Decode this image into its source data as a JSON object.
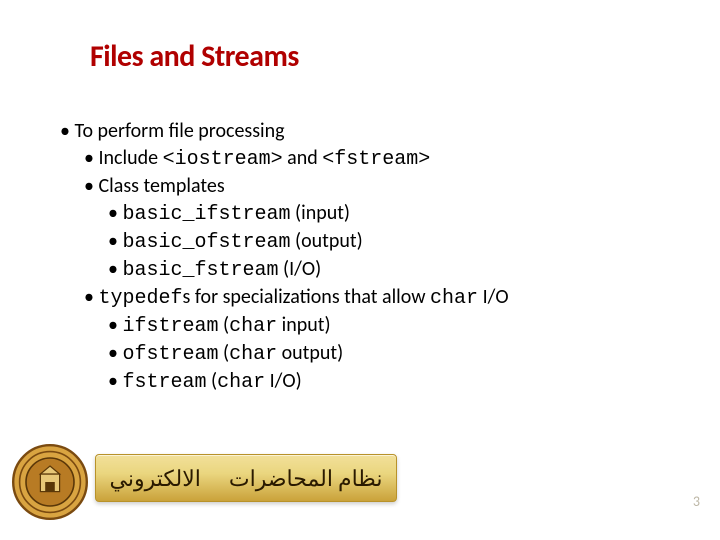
{
  "title": "Files and Streams",
  "bullets": {
    "b0": "To perform file processing",
    "b1_pre": "Include ",
    "b1_c1": "<iostream>",
    "b1_mid": " and ",
    "b1_c2": "<fstream>",
    "b2": "Class templates",
    "b3_c": "basic_ifstream",
    "b3_t": " (input)",
    "b4_c": "basic_ofstream",
    "b4_t": " (output)",
    "b5_c": "basic_fstream",
    "b5_t": " (I/O)",
    "b6_c1": "typedef",
    "b6_t1": "s for specializations that allow ",
    "b6_c2": "char",
    "b6_t2": " I/O",
    "b7_c1": "ifstream",
    "b7_t1": " (",
    "b7_c2": "char",
    "b7_t2": " input)",
    "b8_c1": "ofstream",
    "b8_t1": " (",
    "b8_c2": "char",
    "b8_t2": " output)",
    "b9_c1": "fstream",
    "b9_t1": " (",
    "b9_c2": "char",
    "b9_t2": " I/O)"
  },
  "footer": {
    "right": "نظام المحاضرات",
    "left": "الالكتروني"
  },
  "page_number": "3",
  "colors": {
    "title": "#b00000"
  }
}
